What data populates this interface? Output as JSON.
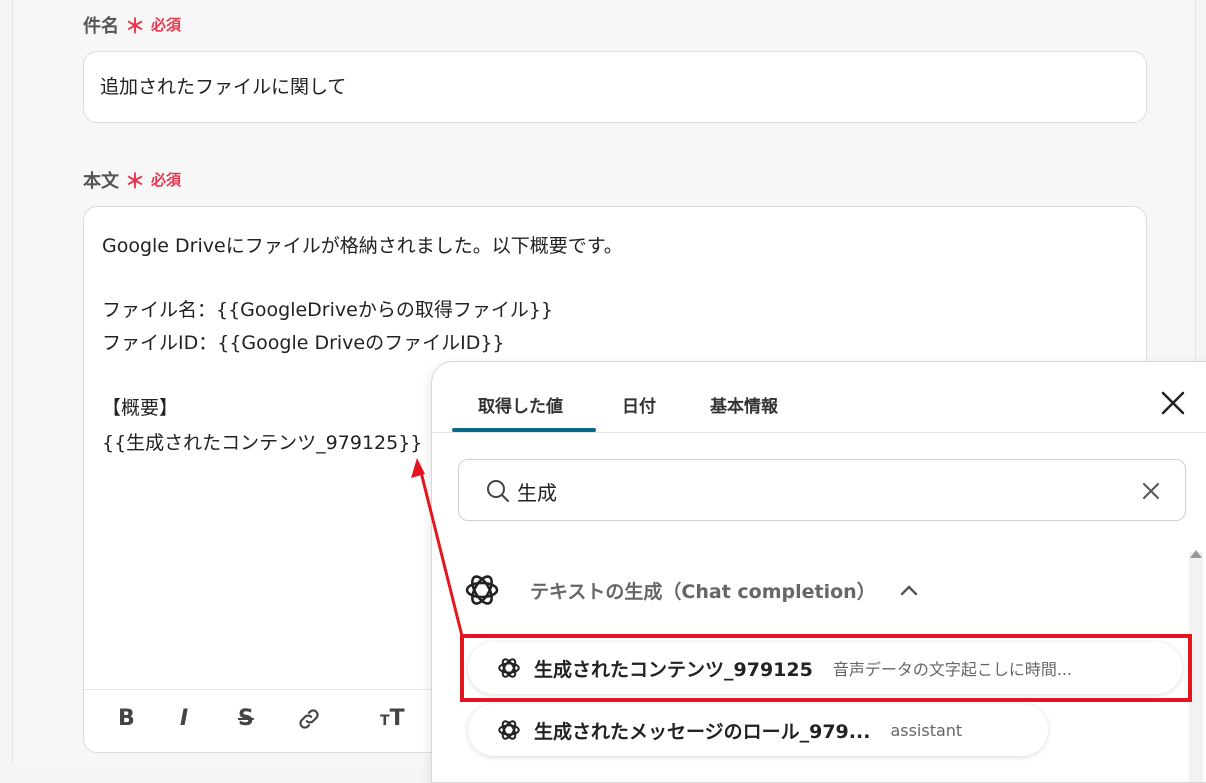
{
  "subject": {
    "label": "件名",
    "required_mark": "＊",
    "required_text": "必須",
    "value": "追加されたファイルに関して"
  },
  "body": {
    "label": "本文",
    "required_mark": "＊",
    "required_text": "必須",
    "lines": [
      "Google Driveにファイルが格納されました。以下概要です。",
      "",
      "ファイル名：{{GoogleDriveからの取得ファイル}}",
      "ファイルID：{{Google DriveのファイルID}}",
      "",
      "【概要】",
      "{{生成されたコンテンツ_979125}}"
    ]
  },
  "toolbar": {
    "bold": "B",
    "italic": "I",
    "strike": "S",
    "link_icon": "link-icon",
    "text_size": "T"
  },
  "picker": {
    "tabs": [
      "取得した値",
      "日付",
      "基本情報"
    ],
    "active_tab": "取得した値",
    "search_value": "生成",
    "group": {
      "title": "テキストの生成（Chat completion）",
      "icon": "openai-icon",
      "expanded": true
    },
    "items": [
      {
        "name": "生成されたコンテンツ_979125",
        "preview": "音声データの文字起こしに時間..."
      },
      {
        "name": "生成されたメッセージのロール_979...",
        "preview": "assistant"
      }
    ]
  },
  "colors": {
    "required": "#e8384f",
    "tab_accent": "#0a6a86",
    "annotation": "#e3151f"
  }
}
